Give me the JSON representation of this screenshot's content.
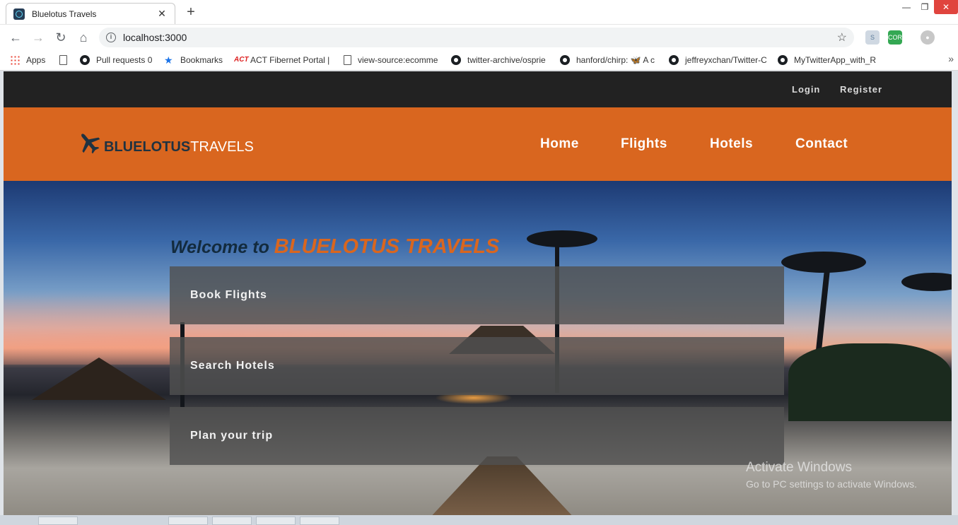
{
  "browser": {
    "tab_title": "Bluelotus Travels",
    "tab_close": "✕",
    "new_tab": "+",
    "window": {
      "minimize": "—",
      "restore": "❐",
      "close": "✕"
    },
    "url": "localhost:3000",
    "info_icon": "i",
    "star_icon": "☆",
    "nav": {
      "back": "←",
      "forward": "→",
      "reload": "↻",
      "home": "⌂"
    },
    "extensions": [
      {
        "name": "skype-extension-icon",
        "label": "S"
      },
      {
        "name": "cors-extension-icon",
        "label": "CORS"
      },
      {
        "name": "profile-icon",
        "label": "●"
      }
    ],
    "bookmarks": [
      {
        "label": "Apps",
        "icon": "apps-icon"
      },
      {
        "label": "Pull requests 0",
        "icon": "github-icon"
      },
      {
        "label": "Bookmarks",
        "icon": "star-icon"
      },
      {
        "label": "ACT Fibernet Portal |",
        "icon": "act-icon"
      },
      {
        "label": "view-source:ecomme",
        "icon": "page-icon"
      },
      {
        "label": "twitter-archive/osprie",
        "icon": "github-icon"
      },
      {
        "label": "hanford/chirp: 🦋 A c",
        "icon": "github-icon"
      },
      {
        "label": "jeffreyxchan/Twitter-C",
        "icon": "github-icon"
      },
      {
        "label": "MyTwitterApp_with_R",
        "icon": "github-icon"
      }
    ],
    "bookmarks_more": "»"
  },
  "site": {
    "topbar": {
      "login": "Login",
      "register": "Register"
    },
    "logo": {
      "part1": "BLUELOTUS",
      "part2": "TRAVELS"
    },
    "nav": {
      "home": "Home",
      "flights": "Flights",
      "hotels": "Hotels",
      "contact": "Contact"
    },
    "welcome": {
      "prefix": "Welcome to ",
      "brand": "BLUELOTUS TRAVELS"
    },
    "panels": [
      "Book Flights",
      "Search Hotels",
      "Plan your trip"
    ]
  },
  "os": {
    "watermark_title": "Activate Windows",
    "watermark_sub": "Go to PC settings to activate Windows."
  },
  "colors": {
    "brand_orange": "#d9661f",
    "brand_navy": "#132b3e",
    "topbar": "#222222"
  }
}
